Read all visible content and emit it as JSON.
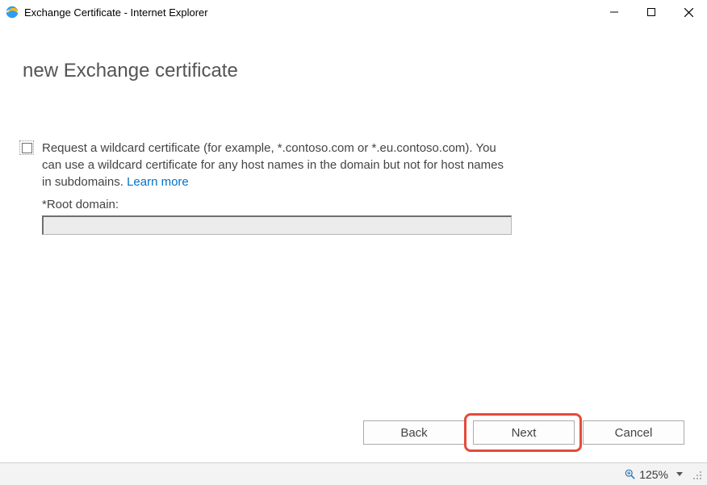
{
  "titlebar": {
    "title": "Exchange Certificate - Internet Explorer"
  },
  "page": {
    "heading": "new Exchange certificate"
  },
  "wildcard": {
    "checked": false,
    "description_pre": "Request a wildcard certificate (for example, *.contoso.com or *.eu.contoso.com). You can use a wildcard certificate for any host names in the domain but not for host names in subdomains. ",
    "learn_more": "Learn more",
    "field_label": "*Root domain:",
    "field_value": ""
  },
  "buttons": {
    "back": "Back",
    "next": "Next",
    "cancel": "Cancel"
  },
  "statusbar": {
    "zoom_text": "125%"
  }
}
